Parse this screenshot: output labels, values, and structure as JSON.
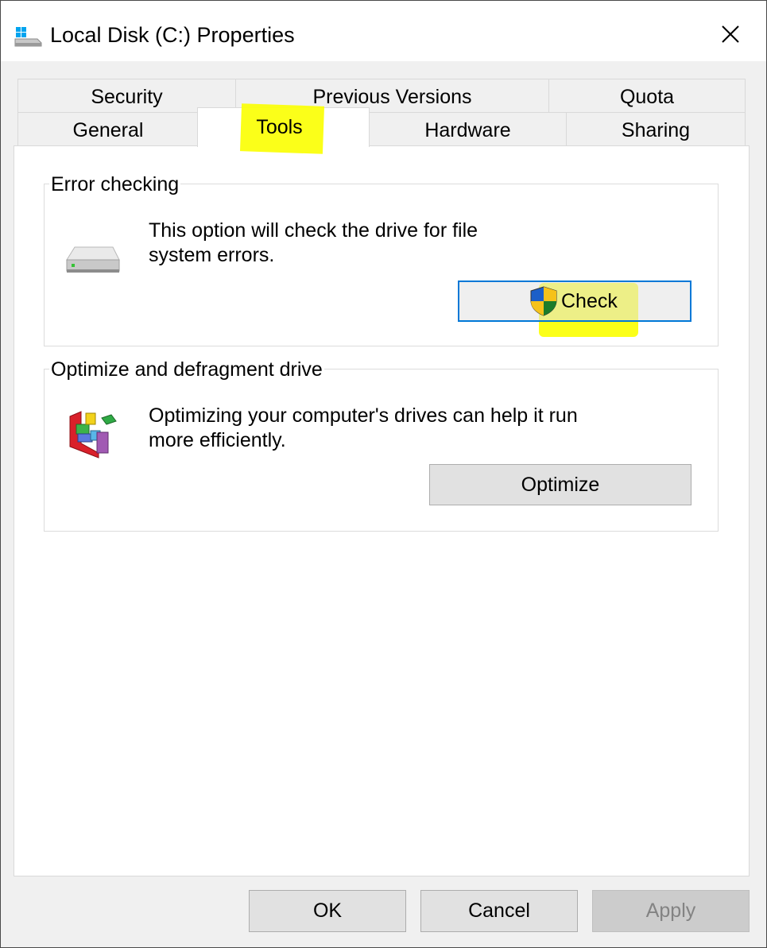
{
  "window": {
    "title": "Local Disk (C:) Properties",
    "close_glyph": "✕"
  },
  "tabs": {
    "row1": [
      {
        "label": "Security"
      },
      {
        "label": "Previous Versions"
      },
      {
        "label": "Quota"
      }
    ],
    "row2": [
      {
        "label": "General"
      },
      {
        "label": "Tools",
        "active": true
      },
      {
        "label": "Hardware"
      },
      {
        "label": "Sharing"
      }
    ]
  },
  "error_checking": {
    "title": "Error checking",
    "description_line1": "This option will check the drive for file",
    "description_line2": "system errors.",
    "check_label": "Check"
  },
  "optimize": {
    "title": "Optimize and defragment drive",
    "description_line1": "Optimizing your computer's drives can help it run",
    "description_line2": "more efficiently.",
    "optimize_label": "Optimize"
  },
  "footer": {
    "ok_label": "OK",
    "cancel_label": "Cancel",
    "apply_label": "Apply"
  },
  "icons": {
    "title": "drive-icon",
    "error_checking": "hard-drive-icon",
    "optimize": "defragment-icon",
    "check_button": "uac-shield-icon"
  },
  "colors": {
    "highlight": "#fbff00",
    "focus_border": "#0078d7",
    "button_face": "#e1e1e1"
  }
}
